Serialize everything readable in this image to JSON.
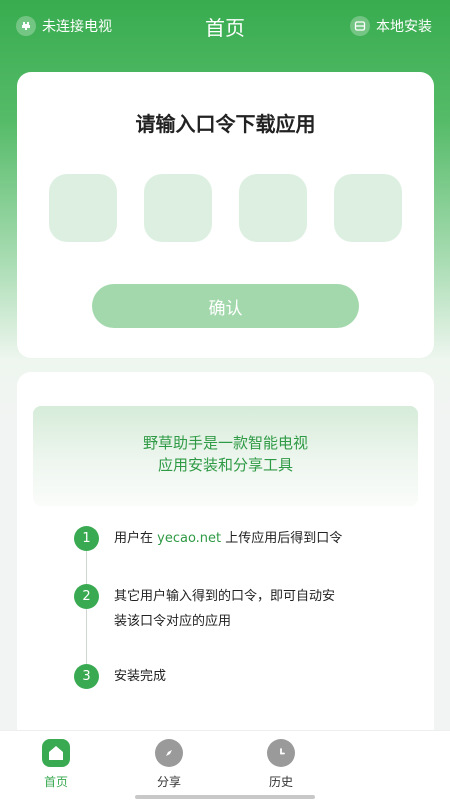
{
  "header": {
    "tv_status": "未连接电视",
    "title": "首页",
    "local_install": "本地安装",
    "tv_icon": "plugin-icon",
    "local_icon": "storage-icon"
  },
  "code_card": {
    "title": "请输入口令下载应用",
    "inputs": [
      {
        "value": "",
        "placeholder": ""
      },
      {
        "value": "",
        "placeholder": ""
      },
      {
        "value": "",
        "placeholder": ""
      },
      {
        "value": "",
        "placeholder": ""
      }
    ],
    "confirm_label": "确认"
  },
  "info_card": {
    "intro_line1": "野草助手是一款智能电视",
    "intro_line2": "应用安装和分享工具",
    "steps": [
      {
        "num": "1",
        "text_before": "用户在 ",
        "link": "yecao.net",
        "text_after": " 上传应用后得到口令"
      },
      {
        "num": "2",
        "text_line1": "其它用户输入得到的口令，即可自动安",
        "text_line2": "装该口令对应的应用"
      },
      {
        "num": "3",
        "text": "安装完成"
      }
    ]
  },
  "tabbar": {
    "tabs": [
      {
        "label": "首页",
        "icon": "home-icon",
        "active": true
      },
      {
        "label": "分享",
        "icon": "compass-icon",
        "active": false
      },
      {
        "label": "历史",
        "icon": "clock-icon",
        "active": false
      }
    ]
  },
  "colors": {
    "brand_green": "#38ac4f",
    "active_tab": "#3aaa52",
    "inactive_tab": "#9a9a9a"
  }
}
